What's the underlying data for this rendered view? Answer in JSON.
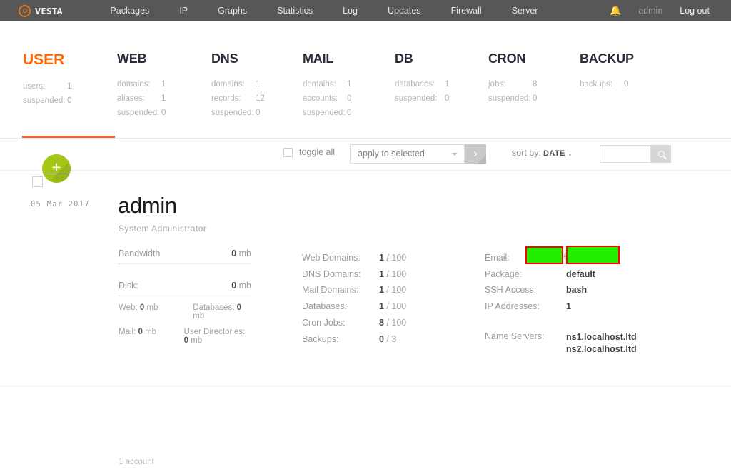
{
  "topbar": {
    "logo": "VESTA",
    "nav": [
      {
        "label": "Packages"
      },
      {
        "label": "IP"
      },
      {
        "label": "Graphs"
      },
      {
        "label": "Statistics"
      },
      {
        "label": "Log"
      },
      {
        "label": "Updates"
      },
      {
        "label": "Firewall"
      },
      {
        "label": "Server"
      }
    ],
    "bell": "▲",
    "user": "admin",
    "logout": "Log out",
    "bell_color": "#c6d92e",
    "bg_color": "#575757"
  },
  "stats": {
    "columns": [
      {
        "title": "USER",
        "active": true,
        "rows": [
          {
            "key": "users:",
            "value": "1"
          },
          {
            "key": "suspended:",
            "value": "0"
          }
        ]
      },
      {
        "title": "WEB",
        "active": false,
        "rows": [
          {
            "key": "domains:",
            "value": "1"
          },
          {
            "key": "aliases:",
            "value": "1"
          },
          {
            "key": "suspended:",
            "value": "0"
          }
        ]
      },
      {
        "title": "DNS",
        "active": false,
        "rows": [
          {
            "key": "domains:",
            "value": "1"
          },
          {
            "key": "records:",
            "value": "12"
          },
          {
            "key": "suspended:",
            "value": "0"
          }
        ]
      },
      {
        "title": "MAIL",
        "active": false,
        "rows": [
          {
            "key": "domains:",
            "value": "1"
          },
          {
            "key": "accounts:",
            "value": "0"
          },
          {
            "key": "suspended:",
            "value": "0"
          }
        ]
      },
      {
        "title": "DB",
        "active": false,
        "rows": [
          {
            "key": "databases:",
            "value": "1"
          },
          {
            "key": "suspended:",
            "value": "0"
          }
        ]
      },
      {
        "title": "CRON",
        "active": false,
        "rows": [
          {
            "key": "jobs:",
            "value": "8"
          },
          {
            "key": "suspended:",
            "value": "0"
          }
        ]
      },
      {
        "title": "BACKUP",
        "active": false,
        "rows": [
          {
            "key": "backups:",
            "value": "0"
          }
        ]
      }
    ],
    "active_color": "#ff6600"
  },
  "toolbar": {
    "toggle_all_label": "toggle all",
    "apply_selected_value": "apply to selected",
    "apply_go_glyph": "›",
    "sort_by_label": "sort by:",
    "sort_by_value": "DATE",
    "sort_direction": "↓",
    "search_value": "",
    "search_placeholder": "",
    "tab_underline_color": "#f4622f"
  },
  "list": {
    "add_button_glyph": "+",
    "add_button_color": "#a3c617",
    "row": {
      "date": "05 Mar 2017",
      "name": "admin",
      "role": "System Administrator",
      "usage": {
        "bandwidth_label": "Bandwidth",
        "bandwidth_value": "0",
        "bandwidth_unit": "mb",
        "disk_label": "Disk:",
        "disk_value": "0",
        "disk_unit": "mb",
        "sub": [
          {
            "label": "Web:",
            "value": "0",
            "unit": "mb"
          },
          {
            "label": "Databases:",
            "value": "0",
            "unit": "mb"
          },
          {
            "label": "Mail:",
            "value": "0",
            "unit": "mb"
          },
          {
            "label": "User Directories:",
            "value": "0",
            "unit": "mb"
          }
        ]
      },
      "counters": [
        {
          "label": "Web Domains:",
          "used": "1",
          "limit": "/ 100"
        },
        {
          "label": "DNS Domains:",
          "used": "1",
          "limit": "/ 100"
        },
        {
          "label": "Mail Domains:",
          "used": "1",
          "limit": "/ 100"
        },
        {
          "label": "Databases:",
          "used": "1",
          "limit": "/ 100"
        },
        {
          "label": "Cron Jobs:",
          "used": "8",
          "limit": "/ 100"
        },
        {
          "label": "Backups:",
          "used": "0",
          "limit": "/ 3"
        }
      ],
      "details": [
        {
          "label": "Email:",
          "value": ""
        },
        {
          "label": "Package:",
          "value": "default"
        },
        {
          "label": "SSH Access:",
          "value": "bash"
        },
        {
          "label": "IP Addresses:",
          "value": "1"
        }
      ],
      "name_servers_label": "Name Servers:",
      "name_servers": [
        "ns1.localhost.ltd",
        "ns2.localhost.ltd"
      ],
      "email_at": "@",
      "redaction_fill": "#22ee00",
      "redaction_border": "#ff0000"
    }
  },
  "footer": {
    "count": "1 account"
  }
}
